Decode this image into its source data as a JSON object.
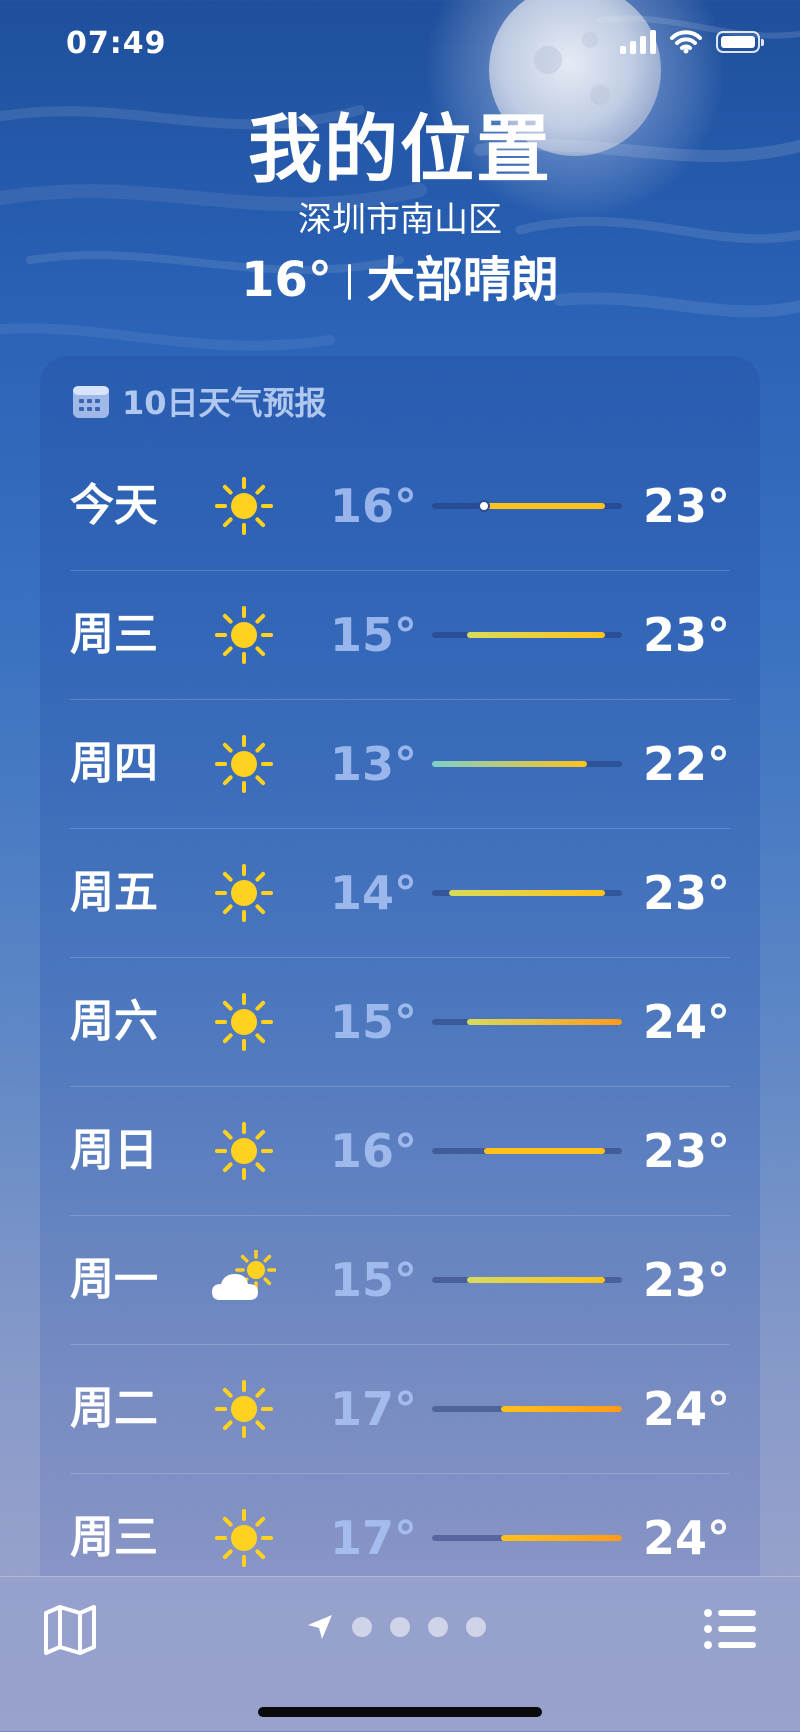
{
  "status_bar": {
    "time": "07:49",
    "icons": [
      "signal-icon",
      "wifi-icon",
      "battery-icon"
    ]
  },
  "location": {
    "title": "我的位置",
    "subtitle": "深圳市南山区",
    "current_temp": "16°",
    "condition": "大部晴朗"
  },
  "forecast": {
    "header_icon": "calendar-icon",
    "header_label": "10日天气预报",
    "range_min": 13,
    "range_max": 24,
    "days": [
      {
        "day": "今天",
        "icon": "sun-icon",
        "low_label": "16°",
        "high_label": "23°",
        "low": 16,
        "high": 23,
        "current": 16
      },
      {
        "day": "周三",
        "icon": "sun-icon",
        "low_label": "15°",
        "high_label": "23°",
        "low": 15,
        "high": 23
      },
      {
        "day": "周四",
        "icon": "sun-icon",
        "low_label": "13°",
        "high_label": "22°",
        "low": 13,
        "high": 22
      },
      {
        "day": "周五",
        "icon": "sun-icon",
        "low_label": "14°",
        "high_label": "23°",
        "low": 14,
        "high": 23
      },
      {
        "day": "周六",
        "icon": "sun-icon",
        "low_label": "15°",
        "high_label": "24°",
        "low": 15,
        "high": 24
      },
      {
        "day": "周日",
        "icon": "sun-icon",
        "low_label": "16°",
        "high_label": "23°",
        "low": 16,
        "high": 23
      },
      {
        "day": "周一",
        "icon": "partly-cloudy-icon",
        "low_label": "15°",
        "high_label": "23°",
        "low": 15,
        "high": 23
      },
      {
        "day": "周二",
        "icon": "sun-icon",
        "low_label": "17°",
        "high_label": "24°",
        "low": 17,
        "high": 24
      },
      {
        "day": "周三",
        "icon": "sun-icon",
        "low_label": "17°",
        "high_label": "24°",
        "low": 17,
        "high": 24
      }
    ]
  },
  "toolbar": {
    "left_icon": "map-icon",
    "right_icon": "list-icon",
    "page_icon": "location-arrow-icon",
    "extra_pages": 4
  },
  "colors": {
    "sun": "#ffd21f",
    "bar_cool": "#7fd0c8",
    "bar_mid": "#d7dc5c",
    "bar_warm": "#ffc21a",
    "bar_hot": "#ff9a1a"
  }
}
